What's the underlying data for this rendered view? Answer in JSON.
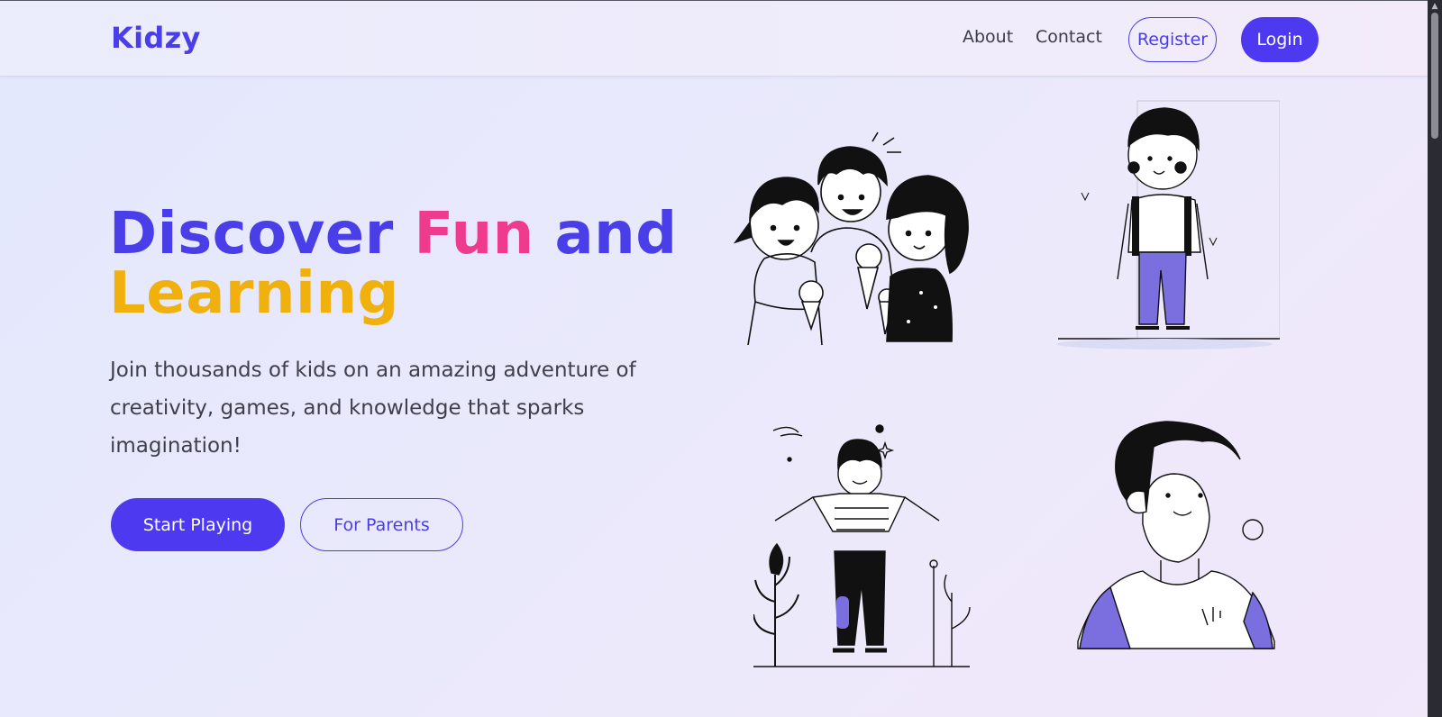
{
  "header": {
    "logo": "Kidzy",
    "nav": {
      "about": "About",
      "contact": "Contact"
    },
    "register_label": "Register",
    "login_label": "Login"
  },
  "hero": {
    "title_words": {
      "discover": "Discover",
      "fun": "Fun",
      "and": "and",
      "learning": "Learning"
    },
    "subtitle": "Join thousands of kids on an amazing adventure of creativity, games, and knowledge that sparks imagination!",
    "start_label": "Start Playing",
    "parents_label": "For Parents"
  },
  "illustrations": [
    "kids-with-ice-cream-illustration",
    "standing-boy-with-backpack-illustration",
    "waving-boy-with-plants-illustration",
    "smiling-boy-portrait-illustration"
  ],
  "colors": {
    "primary": "#4a3ee8",
    "pink": "#ee3b8e",
    "yellow": "#f0b00e",
    "accent_fill": "#7b6fe0"
  }
}
